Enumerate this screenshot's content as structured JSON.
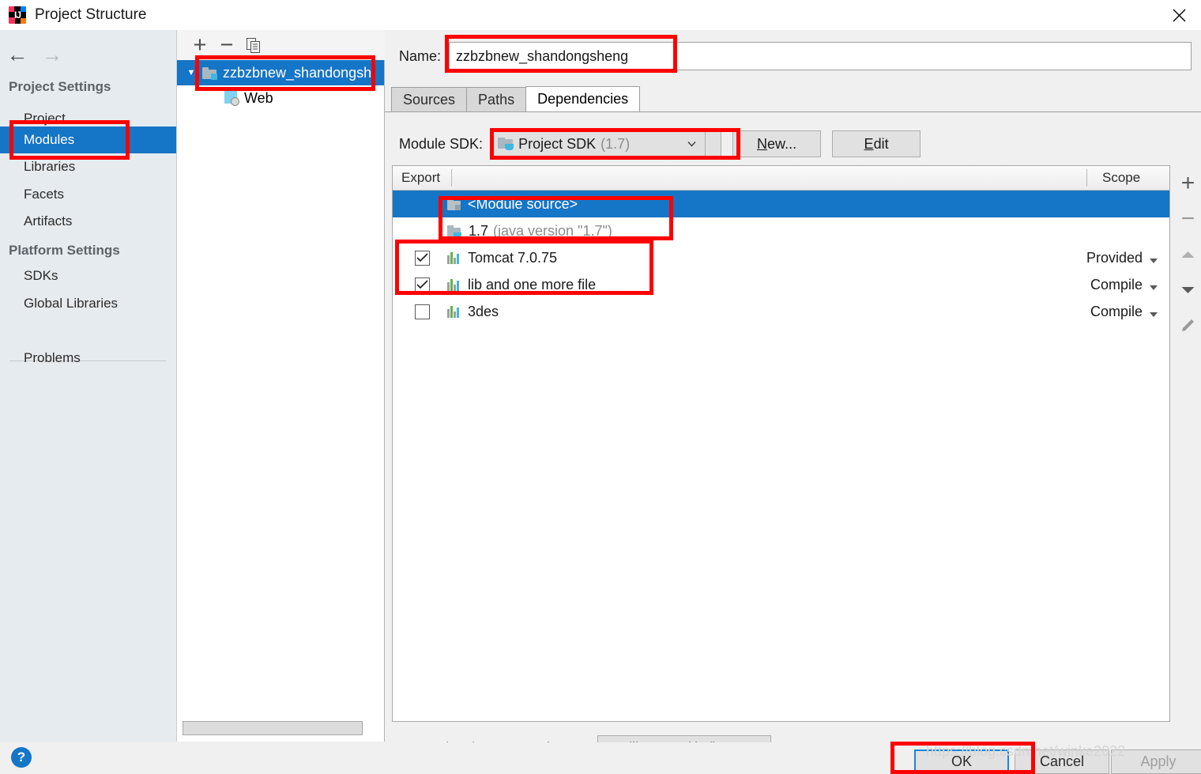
{
  "window": {
    "title": "Project Structure",
    "app_icon": "intellij-idea-icon",
    "close_icon": "close-icon"
  },
  "sidebar": {
    "back_icon": "arrow-left-icon",
    "forward_icon": "arrow-right-icon",
    "groups": [
      {
        "title": "Project Settings",
        "items": [
          {
            "label": "Project",
            "selected": false
          },
          {
            "label": "Modules",
            "selected": true
          },
          {
            "label": "Libraries",
            "selected": false
          },
          {
            "label": "Facets",
            "selected": false
          },
          {
            "label": "Artifacts",
            "selected": false
          }
        ]
      },
      {
        "title": "Platform Settings",
        "items": [
          {
            "label": "SDKs",
            "selected": false
          },
          {
            "label": "Global Libraries",
            "selected": false
          }
        ]
      }
    ],
    "problems_label": "Problems"
  },
  "tree_panel": {
    "toolbar": {
      "add_icon": "plus-icon",
      "remove_icon": "minus-icon",
      "copy_icon": "copy-icon"
    },
    "nodes": [
      {
        "label": "zzbzbnew_shandongsh",
        "icon": "module-folder-icon",
        "selected": true,
        "expanded": true
      },
      {
        "label": "Web",
        "icon": "web-facet-icon",
        "selected": false,
        "child": true
      }
    ]
  },
  "main": {
    "name_label": "Name:",
    "name_value": "zzbzbnew_shandongsheng",
    "tabs": [
      {
        "label": "Sources",
        "active": false
      },
      {
        "label": "Paths",
        "active": false
      },
      {
        "label": "Dependencies",
        "active": true
      }
    ],
    "sdk_label": "Module SDK:",
    "sdk_value": "Project SDK",
    "sdk_version": "(1.7)",
    "sdk_icon": "jdk-folder-icon",
    "sdk_dropdown_icon": "chevron-down-icon",
    "new_button": "New...",
    "new_button_mnemonic": "N",
    "edit_button": "Edit",
    "edit_button_mnemonic": "E",
    "table": {
      "columns": [
        "Export",
        "Scope"
      ],
      "rows": [
        {
          "name": "<Module source>",
          "sub": "",
          "icon": "module-source-icon",
          "checkbox": null,
          "scope": "",
          "selected": true
        },
        {
          "name": "1.7",
          "sub": "(java version \"1.7\")",
          "icon": "jdk-folder-icon",
          "checkbox": null,
          "scope": "",
          "selected": false
        },
        {
          "name": "Tomcat 7.0.75",
          "sub": "",
          "icon": "library-icon",
          "checkbox": true,
          "scope": "Provided",
          "selected": false
        },
        {
          "name": "lib and one more file",
          "sub": "",
          "icon": "library-icon",
          "checkbox": true,
          "scope": "Compile",
          "selected": false
        },
        {
          "name": "3des",
          "sub": "",
          "icon": "library-icon",
          "checkbox": false,
          "scope": "Compile",
          "selected": false
        }
      ]
    },
    "side_toolbar": {
      "add_icon": "plus-icon",
      "remove_icon": "minus-icon",
      "move_up_icon": "triangle-up-icon",
      "move_down_icon": "triangle-down-icon",
      "edit_icon": "pencil-icon"
    },
    "storage_label": "Dependencies storage format:",
    "storage_value": "IntelliJ IDEA (.iml)",
    "storage_dropdown_icon": "chevron-down-icon"
  },
  "footer": {
    "help_icon": "help-question-icon",
    "ok_button": "OK",
    "cancel_button": "Cancel",
    "apply_button": "Apply",
    "watermark": "https://blog.csdn.net/winke2022"
  },
  "colors": {
    "selection_blue": "#1575c6",
    "annotation_red": "#ff0000",
    "sidebar_bg": "#e6ebef",
    "panel_bg": "#f0f0f0"
  }
}
